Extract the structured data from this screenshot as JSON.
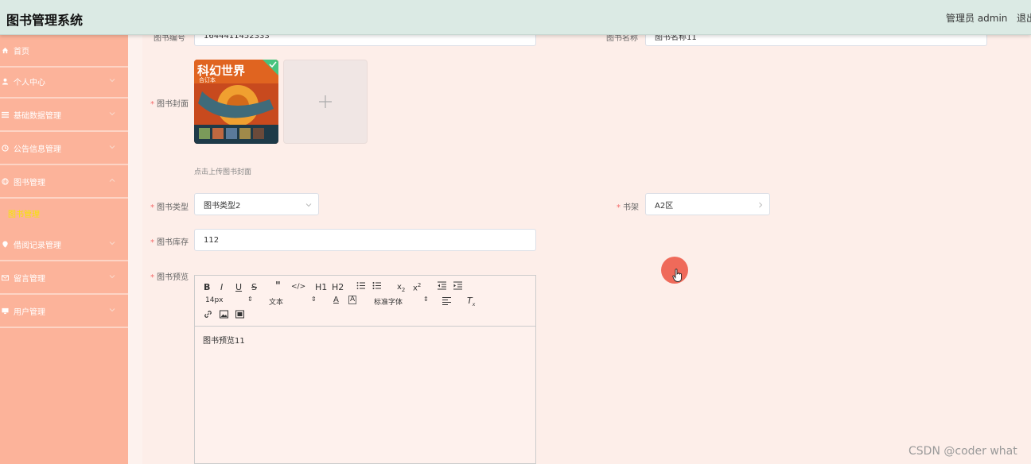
{
  "header": {
    "app_title": "图书管理系统",
    "admin_user": "管理员 admin",
    "logout_label": "退出"
  },
  "sidebar": {
    "items": [
      {
        "label": "首页",
        "icon": "home-icon"
      },
      {
        "label": "个人中心",
        "icon": "user-icon"
      },
      {
        "label": "基础数据管理",
        "icon": "list-icon"
      },
      {
        "label": "公告信息管理",
        "icon": "clock-icon"
      },
      {
        "label": "图书管理",
        "icon": "globe-icon"
      },
      {
        "label": "借阅记录管理",
        "icon": "location-icon"
      },
      {
        "label": "留言管理",
        "icon": "mail-icon"
      },
      {
        "label": "用户管理",
        "icon": "monitor-icon"
      }
    ],
    "active_sub": "图书管理"
  },
  "form": {
    "book_number": {
      "label": "图书编号",
      "value": "1644411452333"
    },
    "book_name": {
      "label": "图书名称",
      "value": "图书名称11"
    },
    "cover": {
      "label": "图书封面",
      "image_title": "科幻世界",
      "image_subtitle": "合订本",
      "hint": "点击上传图书封面"
    },
    "book_type": {
      "label": "图书类型",
      "value": "图书类型2"
    },
    "bookshelf": {
      "label": "书架",
      "value": "A2区"
    },
    "stock": {
      "label": "图书库存",
      "value": "112"
    },
    "preview": {
      "label": "图书预览",
      "content": "图书预览11"
    }
  },
  "editor_toolbar": {
    "font_size": "14px",
    "text_type": "文本",
    "font_family": "标准字体",
    "h1": "H1",
    "h2": "H2"
  },
  "watermark": "CSDN @coder what",
  "colors": {
    "topbar": "#dbeae4",
    "sidebar": "#fcb39a",
    "content_bg": "#fdeee9",
    "active_sub": "#f5e600",
    "required": "#f56c6c"
  }
}
